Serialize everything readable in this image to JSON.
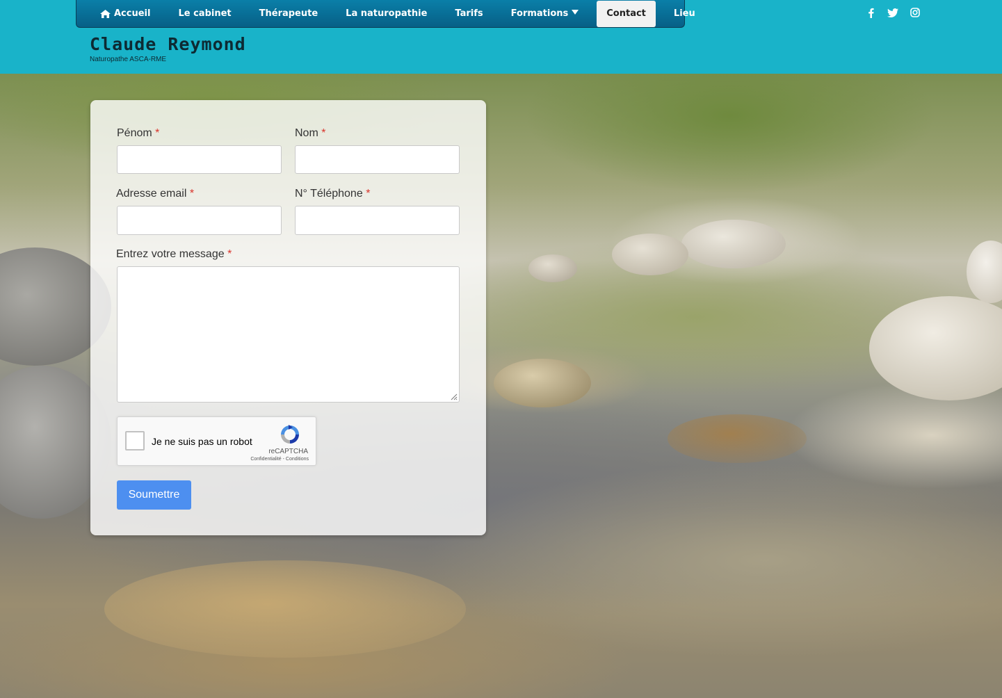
{
  "nav": {
    "items": [
      {
        "label": "Accueil",
        "icon": "home-icon"
      },
      {
        "label": "Le cabinet"
      },
      {
        "label": "Thérapeute"
      },
      {
        "label": "La naturopathie"
      },
      {
        "label": "Tarifs"
      },
      {
        "label": "Formations",
        "icon": "caret-down-icon"
      },
      {
        "label": "Contact",
        "active": true
      },
      {
        "label": "Lieu"
      }
    ]
  },
  "social": [
    "facebook-icon",
    "twitter-icon",
    "instagram-icon"
  ],
  "brand": {
    "title": "Claude Reymond",
    "subtitle": "Naturopathe ASCA-RME"
  },
  "form": {
    "firstname_label": "Pénom",
    "lastname_label": "Nom",
    "email_label": "Adresse email",
    "phone_label": "N° Téléphone",
    "message_label": "Entrez votre message",
    "required_mark": "*",
    "firstname_value": "",
    "lastname_value": "",
    "email_value": "",
    "phone_value": "",
    "message_value": "",
    "submit_label": "Soumettre"
  },
  "recaptcha": {
    "label": "Je ne suis pas un robot",
    "brand": "reCAPTCHA",
    "links": "Confidentialité - Conditions",
    "checked": false
  },
  "colors": {
    "header_bg": "#19b3c9",
    "nav_bg": "#075f86",
    "submit_bg": "#4d8ff0",
    "required": "#d9342b"
  }
}
